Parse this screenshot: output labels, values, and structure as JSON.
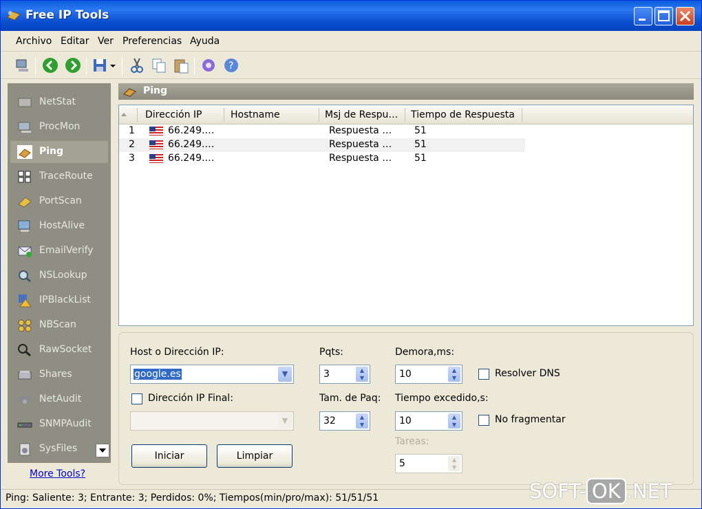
{
  "window": {
    "title": "Free IP Tools"
  },
  "menu": [
    "Archivo",
    "Editar",
    "Ver",
    "Preferencias",
    "Ayuda"
  ],
  "sidebar": {
    "items": [
      {
        "label": "NetStat",
        "icon": "netstat-icon"
      },
      {
        "label": "ProcMon",
        "icon": "procmon-icon"
      },
      {
        "label": "Ping",
        "icon": "ping-icon",
        "active": true
      },
      {
        "label": "TraceRoute",
        "icon": "traceroute-icon"
      },
      {
        "label": "PortScan",
        "icon": "portscan-icon"
      },
      {
        "label": "HostAlive",
        "icon": "hostalive-icon"
      },
      {
        "label": "EmailVerify",
        "icon": "emailverify-icon"
      },
      {
        "label": "NSLookup",
        "icon": "nslookup-icon"
      },
      {
        "label": "IPBlackList",
        "icon": "ipblacklist-icon"
      },
      {
        "label": "NBScan",
        "icon": "nbscan-icon"
      },
      {
        "label": "RawSocket",
        "icon": "rawsocket-icon"
      },
      {
        "label": "Shares",
        "icon": "shares-icon"
      },
      {
        "label": "NetAudit",
        "icon": "netaudit-icon"
      },
      {
        "label": "SNMPAudit",
        "icon": "snmpaudit-icon"
      },
      {
        "label": "SysFiles",
        "icon": "sysfiles-icon"
      }
    ],
    "more_tools": "More Tools?"
  },
  "panel": {
    "title": "Ping"
  },
  "table": {
    "columns": [
      "Dirección IP",
      "Hostname",
      "Msj de Respu…",
      "Tiempo de Respuesta"
    ],
    "rows": [
      {
        "num": "1",
        "ip": "66.249.…",
        "hostname": "",
        "msg": "Respuesta …",
        "time": "51"
      },
      {
        "num": "2",
        "ip": "66.249.…",
        "hostname": "",
        "msg": "Respuesta …",
        "time": "51"
      },
      {
        "num": "3",
        "ip": "66.249.…",
        "hostname": "",
        "msg": "Respuesta …",
        "time": "51"
      }
    ]
  },
  "form": {
    "host_label": "Host o Dirección IP:",
    "host_value": "google.es",
    "final_ip_label": "Dirección IP Final:",
    "pqts_label": "Pqts:",
    "pqts_value": "3",
    "tam_label": "Tam. de Paq:",
    "tam_value": "32",
    "demora_label": "Demora,ms:",
    "demora_value": "10",
    "tiempo_label": "Tiempo excedido,s:",
    "tiempo_value": "10",
    "tareas_label": "Tareas:",
    "tareas_value": "5",
    "resolver_label": "Resolver DNS",
    "nofrag_label": "No fragmentar",
    "iniciar": "Iniciar",
    "limpiar": "Limpiar"
  },
  "status": "Ping: Saliente: 3; Entrante: 3; Perdidos: 0%; Tiempos(min/pro/max): 51/51/51",
  "watermark": {
    "a": "SOFT-",
    "b": "OK",
    "c": ".NET"
  }
}
